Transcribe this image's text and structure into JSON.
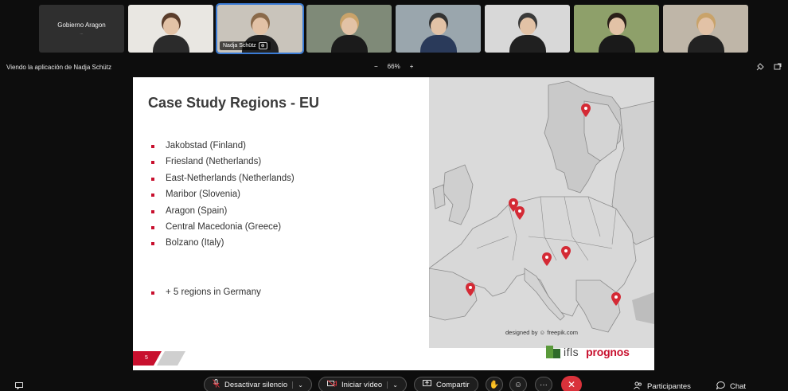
{
  "participants": [
    {
      "name_main": "Gobierno Aragon",
      "name_sub": "...",
      "has_video": false
    },
    {
      "has_video": true,
      "bg": "#e9e7e2",
      "shirt": "#2b2b2b",
      "hair": "#5a3d2b"
    },
    {
      "has_video": true,
      "bg": "#c9c4bb",
      "shirt": "#222",
      "hair": "#8a6a4a",
      "label": "Nadja Schütz",
      "label_badge": "⊕",
      "active": true
    },
    {
      "has_video": true,
      "bg": "#7f8a78",
      "shirt": "#1b1b1b",
      "hair": "#c9a36a"
    },
    {
      "has_video": true,
      "bg": "#9aa6ad",
      "shirt": "#2a3a5a",
      "hair": "#333"
    },
    {
      "has_video": true,
      "bg": "#d8d8d8",
      "shirt": "#202020",
      "hair": "#3a3a3a"
    },
    {
      "has_video": true,
      "bg": "#8ea06a",
      "shirt": "#1a1a1a",
      "hair": "#2a1f18"
    },
    {
      "has_video": true,
      "bg": "#bfb6a8",
      "shirt": "#222",
      "hair": "#c9a36a"
    }
  ],
  "viewbar": {
    "viewing_text": "Viendo la aplicación de Nadja Schütz",
    "zoom_minus": "−",
    "zoom_level": "66%",
    "zoom_plus": "+"
  },
  "slide": {
    "title": "Case Study Regions - EU",
    "regions": [
      "Jakobstad (Finland)",
      "Friesland (Netherlands)",
      "East-Netherlands (Netherlands)",
      "Maribor (Slovenia)",
      "Aragon (Spain)",
      "Central Macedonia (Greece)",
      "Bolzano (Italy)"
    ],
    "extra": "+ 5 regions in Germany",
    "map_credit": "designed by ☺ freepik.com",
    "page_number": "5",
    "logo_ifls": "ifls",
    "logo_prognos": "prognos"
  },
  "controls": {
    "mute_label": "Desactivar silencio",
    "video_label": "Iniciar vídeo",
    "share_label": "Compartir",
    "participants_label": "Participantes",
    "chat_label": "Chat",
    "more_label": "···",
    "leave_symbol": "✕"
  },
  "colors": {
    "accent_red": "#c8102e",
    "leave_red": "#d9323b",
    "active_outline": "#3a7bd5",
    "map_land": "#dcdcdc",
    "map_pin": "#d42a35"
  }
}
